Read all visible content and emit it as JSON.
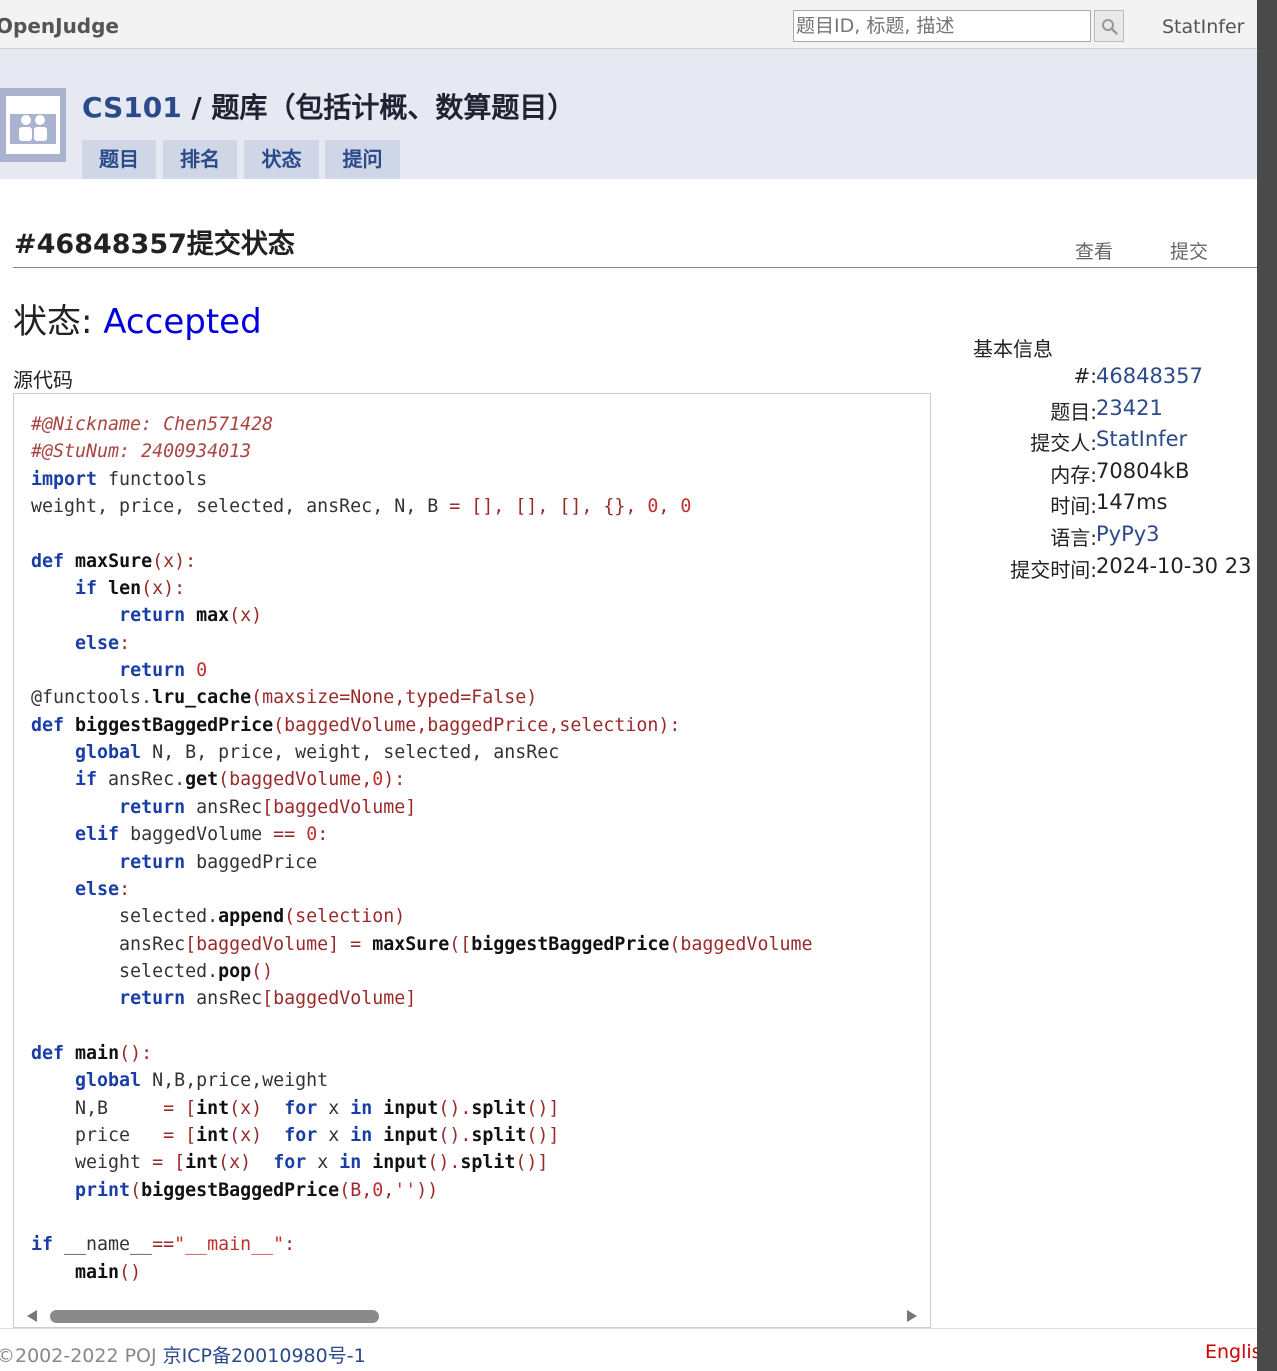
{
  "topbar": {
    "brand": "OpenJudge",
    "search_placeholder": "题目ID, 标题, 描述",
    "user": "StatInfer"
  },
  "header": {
    "course": "CS101",
    "separator": " / ",
    "bank": "题库（包括计概、数算题目）",
    "tabs": [
      {
        "label": "题目"
      },
      {
        "label": "排名"
      },
      {
        "label": "状态"
      },
      {
        "label": "提问"
      }
    ]
  },
  "page": {
    "title": "#46848357提交状态",
    "actions": {
      "view": "查看",
      "submit": "提交"
    },
    "status_label": "状态: ",
    "status_value": "Accepted",
    "source_label": "源代码"
  },
  "code": {
    "lines": [
      [
        [
          "c",
          "#@Nickname: Chen571428"
        ]
      ],
      [
        [
          "c",
          "#@StuNum: 2400934013"
        ]
      ],
      [
        [
          "k",
          "import"
        ],
        [
          "t",
          " functools"
        ]
      ],
      [
        [
          "t",
          "weight, price, selected, ansRec, N, B "
        ],
        [
          "p",
          "="
        ],
        [
          "t",
          " "
        ],
        [
          "p",
          "[], [], [], {}, "
        ],
        [
          "n",
          "0"
        ],
        [
          "p",
          ", "
        ],
        [
          "n",
          "0"
        ]
      ],
      [
        [
          "t",
          ""
        ]
      ],
      [
        [
          "k",
          "def"
        ],
        [
          "t",
          " "
        ],
        [
          "f",
          "maxSure"
        ],
        [
          "p",
          "(x):"
        ]
      ],
      [
        [
          "t",
          "    "
        ],
        [
          "k",
          "if"
        ],
        [
          "t",
          " "
        ],
        [
          "f",
          "len"
        ],
        [
          "p",
          "(x):"
        ]
      ],
      [
        [
          "t",
          "        "
        ],
        [
          "k",
          "return"
        ],
        [
          "t",
          " "
        ],
        [
          "f",
          "max"
        ],
        [
          "p",
          "(x)"
        ]
      ],
      [
        [
          "t",
          "    "
        ],
        [
          "k",
          "else"
        ],
        [
          "p",
          ":"
        ]
      ],
      [
        [
          "t",
          "        "
        ],
        [
          "k",
          "return"
        ],
        [
          "t",
          " "
        ],
        [
          "n",
          "0"
        ]
      ],
      [
        [
          "t",
          "@functools."
        ],
        [
          "f",
          "lru_cache"
        ],
        [
          "p",
          "(maxsize=None,typed=False)"
        ]
      ],
      [
        [
          "k",
          "def"
        ],
        [
          "t",
          " "
        ],
        [
          "f",
          "biggestBaggedPrice"
        ],
        [
          "p",
          "(baggedVolume,baggedPrice,selection):"
        ]
      ],
      [
        [
          "t",
          "    "
        ],
        [
          "k",
          "global"
        ],
        [
          "t",
          " N, B, price, weight, selected, ansRec"
        ]
      ],
      [
        [
          "t",
          "    "
        ],
        [
          "k",
          "if"
        ],
        [
          "t",
          " ansRec."
        ],
        [
          "f",
          "get"
        ],
        [
          "p",
          "(baggedVolume,"
        ],
        [
          "n",
          "0"
        ],
        [
          "p",
          "):"
        ]
      ],
      [
        [
          "t",
          "        "
        ],
        [
          "k",
          "return"
        ],
        [
          "t",
          " ansRec"
        ],
        [
          "p",
          "[baggedVolume]"
        ]
      ],
      [
        [
          "t",
          "    "
        ],
        [
          "k",
          "elif"
        ],
        [
          "t",
          " baggedVolume "
        ],
        [
          "p",
          "=="
        ],
        [
          "t",
          " "
        ],
        [
          "n",
          "0"
        ],
        [
          "p",
          ":"
        ]
      ],
      [
        [
          "t",
          "        "
        ],
        [
          "k",
          "return"
        ],
        [
          "t",
          " baggedPrice"
        ]
      ],
      [
        [
          "t",
          "    "
        ],
        [
          "k",
          "else"
        ],
        [
          "p",
          ":"
        ]
      ],
      [
        [
          "t",
          "        selected."
        ],
        [
          "f",
          "append"
        ],
        [
          "p",
          "(selection)"
        ]
      ],
      [
        [
          "t",
          "        ansRec"
        ],
        [
          "p",
          "[baggedVolume] = "
        ],
        [
          "f",
          "maxSure"
        ],
        [
          "p",
          "(["
        ],
        [
          "f",
          "biggestBaggedPrice"
        ],
        [
          "p",
          "(baggedVolume"
        ]
      ],
      [
        [
          "t",
          "        selected."
        ],
        [
          "f",
          "pop"
        ],
        [
          "p",
          "()"
        ]
      ],
      [
        [
          "t",
          "        "
        ],
        [
          "k",
          "return"
        ],
        [
          "t",
          " ansRec"
        ],
        [
          "p",
          "[baggedVolume]"
        ]
      ],
      [
        [
          "t",
          ""
        ]
      ],
      [
        [
          "k",
          "def"
        ],
        [
          "t",
          " "
        ],
        [
          "f",
          "main"
        ],
        [
          "p",
          "():"
        ]
      ],
      [
        [
          "t",
          "    "
        ],
        [
          "k",
          "global"
        ],
        [
          "t",
          " N,B,price,weight"
        ]
      ],
      [
        [
          "t",
          "    N,B     "
        ],
        [
          "p",
          "= ["
        ],
        [
          "f",
          "int"
        ],
        [
          "p",
          "(x)"
        ],
        [
          "t",
          "  "
        ],
        [
          "k",
          "for"
        ],
        [
          "t",
          " x "
        ],
        [
          "k",
          "in"
        ],
        [
          "t",
          " "
        ],
        [
          "f",
          "input"
        ],
        [
          "p",
          "()."
        ],
        [
          "f",
          "split"
        ],
        [
          "p",
          "()]"
        ]
      ],
      [
        [
          "t",
          "    price   "
        ],
        [
          "p",
          "= ["
        ],
        [
          "f",
          "int"
        ],
        [
          "p",
          "(x)"
        ],
        [
          "t",
          "  "
        ],
        [
          "k",
          "for"
        ],
        [
          "t",
          " x "
        ],
        [
          "k",
          "in"
        ],
        [
          "t",
          " "
        ],
        [
          "f",
          "input"
        ],
        [
          "p",
          "()."
        ],
        [
          "f",
          "split"
        ],
        [
          "p",
          "()]"
        ]
      ],
      [
        [
          "t",
          "    weight "
        ],
        [
          "p",
          "= ["
        ],
        [
          "f",
          "int"
        ],
        [
          "p",
          "(x)"
        ],
        [
          "t",
          "  "
        ],
        [
          "k",
          "for"
        ],
        [
          "t",
          " x "
        ],
        [
          "k",
          "in"
        ],
        [
          "t",
          " "
        ],
        [
          "f",
          "input"
        ],
        [
          "p",
          "()."
        ],
        [
          "f",
          "split"
        ],
        [
          "p",
          "()]"
        ]
      ],
      [
        [
          "t",
          "    "
        ],
        [
          "k",
          "print"
        ],
        [
          "p",
          "("
        ],
        [
          "f",
          "biggestBaggedPrice"
        ],
        [
          "p",
          "(B,"
        ],
        [
          "n",
          "0"
        ],
        [
          "p",
          ","
        ],
        [
          "s",
          "''"
        ],
        [
          "p",
          "))"
        ]
      ],
      [
        [
          "t",
          ""
        ]
      ],
      [
        [
          "k",
          "if"
        ],
        [
          "t",
          " __name__"
        ],
        [
          "p",
          "=="
        ],
        [
          "s",
          "\"__main__\""
        ],
        [
          "p",
          ":"
        ]
      ],
      [
        [
          "t",
          "    "
        ],
        [
          "f",
          "main"
        ],
        [
          "p",
          "()"
        ]
      ]
    ]
  },
  "info": {
    "title": "基本信息",
    "rows": [
      {
        "label": "#:",
        "value": "46848357",
        "link": true
      },
      {
        "label": "题目:",
        "value": "23421",
        "link": true
      },
      {
        "label": "提交人:",
        "value": "StatInfer",
        "link": true
      },
      {
        "label": "内存:",
        "value": "70804kB",
        "link": false
      },
      {
        "label": "时间:",
        "value": "147ms",
        "link": false
      },
      {
        "label": "语言:",
        "value": "PyPy3",
        "link": true
      },
      {
        "label": "提交时间:",
        "value": "2024-10-30 23",
        "link": false
      }
    ]
  },
  "footer": {
    "copyright": "©2002-2022 POJ ",
    "icp": "京ICP备20010980号-1",
    "language": "English"
  },
  "colors": {
    "accent": "#2b4a8a",
    "accepted": "#0000dd",
    "header_bg": "#e6e9f2",
    "tab_bg": "#cfd6e6"
  }
}
